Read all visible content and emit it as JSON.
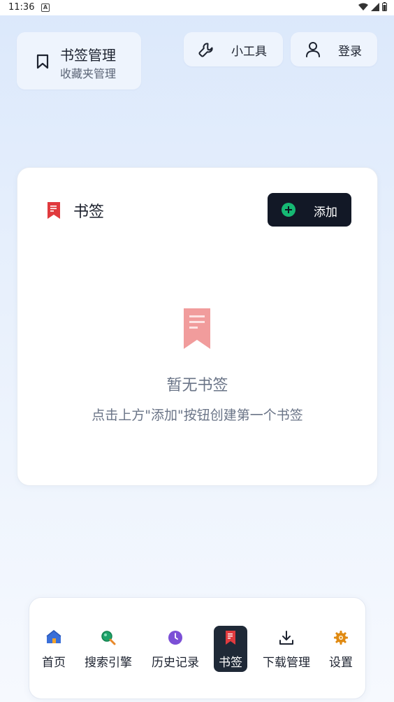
{
  "status_bar": {
    "time": "11:36",
    "notification_glyph": "A"
  },
  "header": {
    "brand_title": "书签管理",
    "brand_subtitle": "收藏夹管理",
    "tools_label": "小工具",
    "login_label": "登录"
  },
  "bookmarks_card": {
    "title": "书签",
    "add_label": "添加",
    "empty_title": "暂无书签",
    "empty_hint": "点击上方\"添加\"按钮创建第一个书签"
  },
  "nav": {
    "items": [
      {
        "label": "首页",
        "icon": "home-icon"
      },
      {
        "label": "搜索引擎",
        "icon": "search-icon"
      },
      {
        "label": "历史记录",
        "icon": "history-clock-icon"
      },
      {
        "label": "书签",
        "icon": "bookmark-icon",
        "active": true
      },
      {
        "label": "下载管理",
        "icon": "download-icon"
      },
      {
        "label": "设置",
        "icon": "settings-gear-icon"
      }
    ]
  },
  "colors": {
    "accent_dark": "#121826",
    "add_green": "#16b873",
    "bookmark_red": "#e03a3e",
    "empty_bookmark": "#f19c9c"
  }
}
